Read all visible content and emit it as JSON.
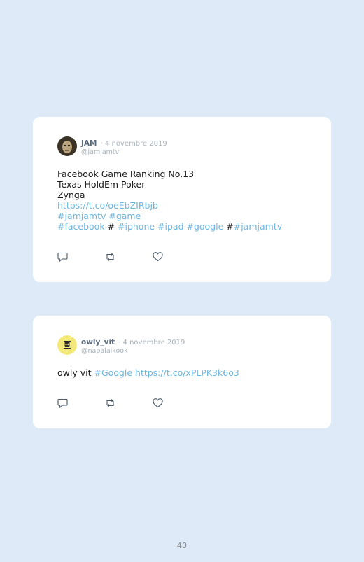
{
  "tweets": [
    {
      "name": "JAM",
      "date": "· 4 novembre 2019",
      "handle": "@jamjamtv",
      "lines": [
        {
          "segments": [
            {
              "text": "Facebook Game Ranking No.13",
              "link": false
            }
          ]
        },
        {
          "segments": [
            {
              "text": "Texas HoldEm Poker",
              "link": false
            }
          ]
        },
        {
          "segments": [
            {
              "text": "Zynga",
              "link": false
            }
          ]
        },
        {
          "segments": [
            {
              "text": "https://t.co/oeEbZIRbjb",
              "link": true
            }
          ]
        },
        {
          "segments": [
            {
              "text": "#jamjamtv #game",
              "link": true
            }
          ]
        },
        {
          "segments": [
            {
              "text": "#facebook",
              "link": true
            },
            {
              "text": " # ",
              "link": false
            },
            {
              "text": "#iphone #ipad #google",
              "link": true
            },
            {
              "text": " #",
              "link": false
            },
            {
              "text": "#jamjamtv",
              "link": true
            }
          ]
        }
      ]
    },
    {
      "name": "owly_vit",
      "date": "· 4 novembre 2019",
      "handle": "@napalaikook",
      "lines": [
        {
          "segments": [
            {
              "text": "owly vit ",
              "link": false
            },
            {
              "text": "#Google",
              "link": true
            },
            {
              "text": " ",
              "link": false
            },
            {
              "text": "https://t.co/xPLPK3k6o3",
              "link": true
            }
          ]
        }
      ]
    }
  ],
  "icons": {
    "reply": "reply-icon",
    "retweet": "retweet-icon",
    "like": "like-icon"
  },
  "colors": {
    "background": "#deeaf7",
    "link": "#6cb6e2",
    "muted": "#a9b1b9"
  },
  "page_number": "40"
}
